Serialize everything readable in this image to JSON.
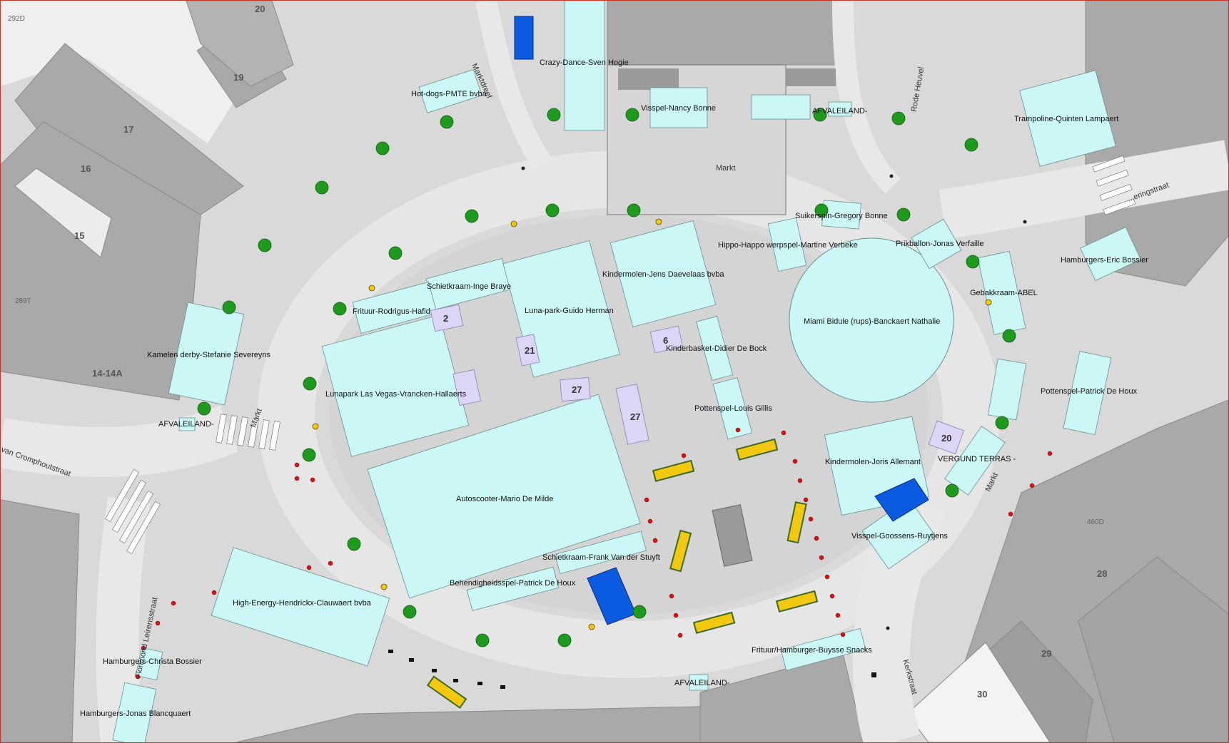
{
  "map": {
    "street_labels": [
      "Markt",
      "Markt",
      "Markt",
      "Markt",
      "Marktdreef",
      "Rode Heuvel",
      "Kerkstraat",
      "Florimond Leirensstraat",
      "van Cromphoutstraat",
      "...eringstraat"
    ],
    "house_numbers": [
      "20",
      "19",
      "17",
      "16",
      "15",
      "14-14A",
      "28",
      "29",
      "30"
    ],
    "parcel_ids": [
      "292D",
      "289T",
      "460D"
    ],
    "stall_labels": [
      "Crazy-Dance-Sven Hogie",
      "Hot-dogs-PMTE bvba",
      "Visspel-Nancy Bonne",
      "AFVALEILAND-",
      "Trampoline-Quinten Lampaert",
      "Suikerspin-Gregory Bonne",
      "Hippo-Happo werpspel-Martine Verbeke",
      "Prikballon-Jonas Verfaille",
      "Hamburgers-Eric Bossier",
      "Kindermolen-Jens Daevelaas bvba",
      "Schietkraam-Inge Braye",
      "Luna-park-Guido Herman",
      "Frituur-Rodrigus-Hafid",
      "Gebakkraam-ABEL",
      "Miami Bidule (rups)-Banckaert Nathalie",
      "Kamelen derby-Stefanie Severeyns",
      "Kinderbasket-Didier De Bock",
      "Lunapark Las Vegas-Vrancken-Hallaerts",
      "Pottenspel-Patrick De Houx",
      "Pottenspel-Louis Gillis",
      "AFVALEILAND-",
      "Kindermolen-Joris Allemant",
      "VERGUND TERRAS -",
      "Autoscooter-Mario De Milde",
      "Visspel-Goossens-Ruytjens",
      "Schietkraam-Frank Van der Stuyft",
      "Behendigheidsspel-Patrick De Houx",
      "High-Energy-Hendrickx-Clauwaert bvba",
      "Frituur/Hamburger-Buysse Snacks",
      "Hamburgers-Christa Bossier",
      "AFVALEILAND-",
      "Hamburgers-Jonas Blancquaert"
    ],
    "numbered_plots": [
      "2",
      "21",
      "27",
      "27",
      "6",
      "20"
    ],
    "colors": {
      "border": "#c0392b",
      "stall_fill": "#ccf7f7",
      "plot_fill": "#ddd5f5",
      "road": "#e6e6e6",
      "building": "#a8a8a8",
      "parking_blue": "#0a5be0",
      "bench_yellow": "#f2c811",
      "tree_green": "#1f9a1f"
    },
    "icons": [
      "tree-icon",
      "wheelchair-parking-icon",
      "bollard-icon",
      "lamp-icon",
      "flag-icon",
      "pedestrian-crossing"
    ]
  }
}
